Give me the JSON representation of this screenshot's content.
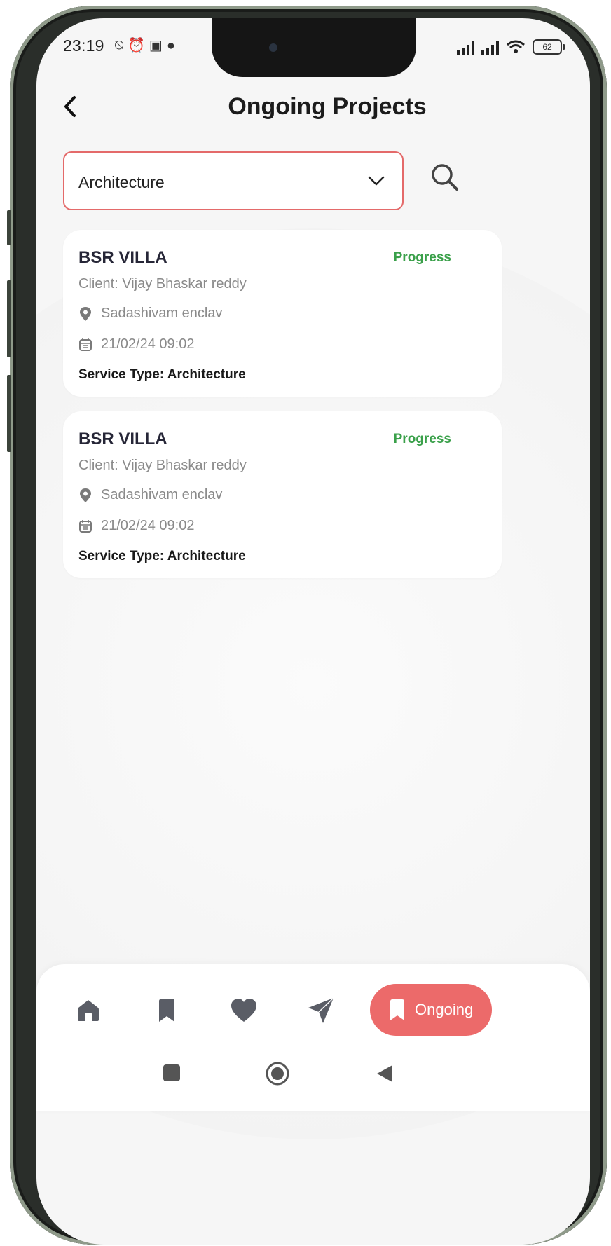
{
  "status_bar": {
    "time": "23:19",
    "left_icons": [
      "mute-icon",
      "alarm-icon",
      "window-icon",
      "notification-dot-icon"
    ],
    "battery": "62"
  },
  "header": {
    "title": "Ongoing Projects",
    "back_icon": "chevron-left-icon"
  },
  "filter": {
    "selected": "Architecture",
    "dropdown_icon": "chevron-down-icon",
    "search_icon": "search-icon"
  },
  "projects": [
    {
      "name": "BSR VILLA",
      "status": "Progress",
      "client": "Client: Vijay Bhaskar reddy",
      "location": "Sadashivam enclav",
      "datetime": "21/02/24 09:02",
      "service": "Service Type: Architecture"
    },
    {
      "name": "BSR VILLA",
      "status": "Progress",
      "client": "Client: Vijay Bhaskar reddy",
      "location": "Sadashivam enclav",
      "datetime": "21/02/24 09:02",
      "service": "Service Type: Architecture"
    }
  ],
  "bottom_nav": {
    "items": [
      "home-icon",
      "bookmark-icon",
      "heart-icon",
      "send-icon"
    ],
    "active_label": "Ongoing",
    "active_icon": "bookmark-icon"
  },
  "colors": {
    "accent": "#ec6a6a",
    "status_green": "#3aa04a",
    "nav_icon": "#5a5d66"
  }
}
